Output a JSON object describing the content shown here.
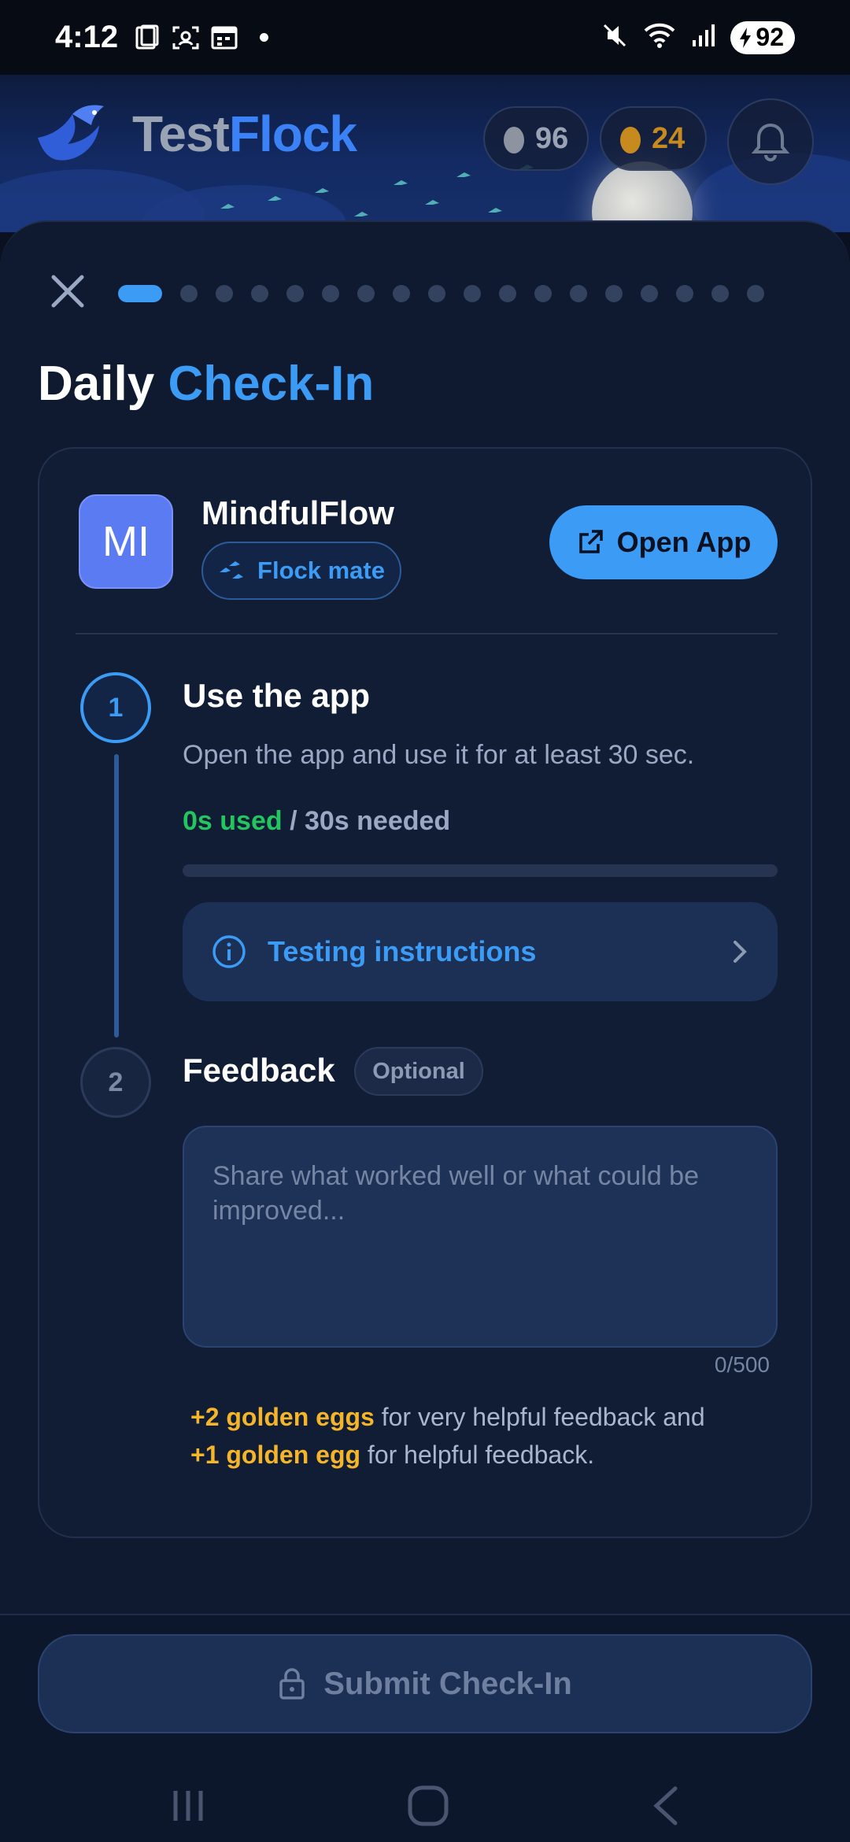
{
  "status_bar": {
    "time": "4:12",
    "battery": "92"
  },
  "header": {
    "brand_part1": "Test",
    "brand_part2": "Flock",
    "silver_eggs": "96",
    "golden_eggs": "24"
  },
  "sheet": {
    "progress": {
      "total_steps": 18,
      "current_step": 1
    },
    "title_part1": "Daily",
    "title_part2": "Check-In",
    "app": {
      "initials": "MI",
      "name": "MindfulFlow",
      "badge": "Flock mate",
      "open_label": "Open App"
    },
    "step1": {
      "number": "1",
      "title": "Use the app",
      "description": "Open the app and use it for at least 30 sec.",
      "used": "0s used",
      "needed": " / 30s needed",
      "progress_fraction": 0,
      "instructions_label": "Testing instructions"
    },
    "step2": {
      "number": "2",
      "title": "Feedback",
      "optional_label": "Optional",
      "placeholder": "Share what worked well or what could be improved...",
      "counter": "0/500",
      "reward_line1_highlight": "+2 golden eggs",
      "reward_line1_rest": " for very helpful feedback and",
      "reward_line2_highlight": "+1 golden egg",
      "reward_line2_rest": " for helpful feedback."
    }
  },
  "footer": {
    "submit_label": "Submit Check-In"
  },
  "colors": {
    "accent": "#3b9bf5",
    "success": "#22c55e",
    "gold": "#f5b52b",
    "background": "#0f1a30"
  }
}
